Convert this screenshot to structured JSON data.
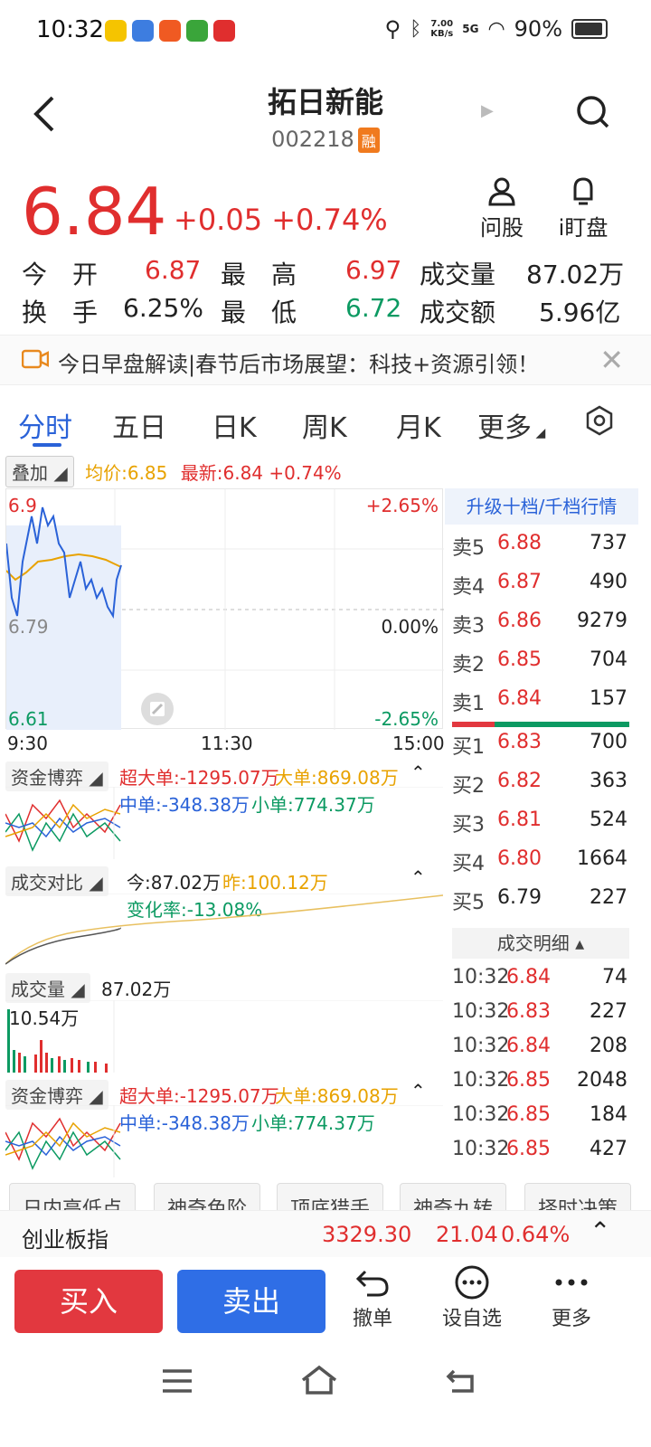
{
  "status": {
    "time": "10:32",
    "net_speed_top": "7.00",
    "net_speed_bottom": "KB/s",
    "signal": "5G",
    "battery": "90%"
  },
  "header": {
    "name": "拓日新能",
    "code": "002218",
    "margin_badge": "融"
  },
  "quote": {
    "price": "6.84",
    "change": "+0.05",
    "change_pct": "+0.74%"
  },
  "actions": {
    "ask": "问股",
    "watch": "i盯盘"
  },
  "stats": {
    "open_label": "今　开",
    "open": "6.87",
    "high_label": "最　高",
    "high": "6.97",
    "volume_label": "成交量",
    "volume": "87.02万",
    "turnover_label": "换　手",
    "turnover": "6.25%",
    "low_label": "最　低",
    "low": "6.72",
    "amount_label": "成交额",
    "amount": "5.96亿"
  },
  "banner": {
    "text": "今日早盘解读|春节后市场展望：科技+资源引领！"
  },
  "tabs": [
    "分时",
    "五日",
    "日K",
    "周K",
    "月K",
    "更多"
  ],
  "legend": {
    "overlay": "叠加",
    "avg": "均价:6.85",
    "latest": "最新:6.84 +0.74%"
  },
  "chart": {
    "y_top": "6.9",
    "y_mid": "6.79",
    "y_bot": "6.61",
    "pct_top": "+2.65%",
    "pct_mid": "0.00%",
    "pct_bot": "-2.65%",
    "x_start": "9:30",
    "x_mid": "11:30",
    "x_end": "15:00"
  },
  "orderbook": {
    "upgrade": "升级十档/千档行情",
    "asks": [
      {
        "label": "卖5",
        "price": "6.88",
        "vol": "737"
      },
      {
        "label": "卖4",
        "price": "6.87",
        "vol": "490"
      },
      {
        "label": "卖3",
        "price": "6.86",
        "vol": "9279"
      },
      {
        "label": "卖2",
        "price": "6.85",
        "vol": "704"
      },
      {
        "label": "卖1",
        "price": "6.84",
        "vol": "157"
      }
    ],
    "bids": [
      {
        "label": "买1",
        "price": "6.83",
        "vol": "700"
      },
      {
        "label": "买2",
        "price": "6.82",
        "vol": "363"
      },
      {
        "label": "买3",
        "price": "6.81",
        "vol": "524"
      },
      {
        "label": "买4",
        "price": "6.80",
        "vol": "1664"
      },
      {
        "label": "买5",
        "price": "6.79",
        "vol": "227"
      }
    ],
    "detail_title": "成交明细",
    "ticks": [
      {
        "time": "10:32",
        "price": "6.84",
        "vol": "74"
      },
      {
        "time": "10:32",
        "price": "6.83",
        "vol": "227"
      },
      {
        "time": "10:32",
        "price": "6.84",
        "vol": "208"
      },
      {
        "time": "10:32",
        "price": "6.85",
        "vol": "2048"
      },
      {
        "time": "10:32",
        "price": "6.85",
        "vol": "184"
      },
      {
        "time": "10:32",
        "price": "6.85",
        "vol": "427"
      }
    ]
  },
  "capital1": {
    "title": "资金博弈",
    "super": "超大单:-1295.07万",
    "large": "大单:869.08万",
    "medium": "中单:-348.38万",
    "small": "小单:774.37万"
  },
  "compare": {
    "title": "成交对比",
    "today": "今:87.02万",
    "yesterday": "昨:100.12万",
    "rate": "变化率:-13.08%"
  },
  "volume": {
    "title": "成交量",
    "value": "87.02万",
    "max": "10.54万"
  },
  "capital2": {
    "title": "资金博弈",
    "super": "超大单:-1295.07万",
    "large": "大单:869.08万",
    "medium": "中单:-348.38万",
    "small": "小单:774.37万"
  },
  "tools": [
    "日内高低点",
    "神奇色阶",
    "顶底猎手",
    "神奇九转",
    "择时决策"
  ],
  "index": {
    "name": "创业板指",
    "value": "3329.30",
    "change": "21.04",
    "pct": "0.64%"
  },
  "trade": {
    "buy": "买入",
    "sell": "卖出",
    "cancel": "撤单",
    "watchlist": "设自选",
    "more": "更多"
  }
}
